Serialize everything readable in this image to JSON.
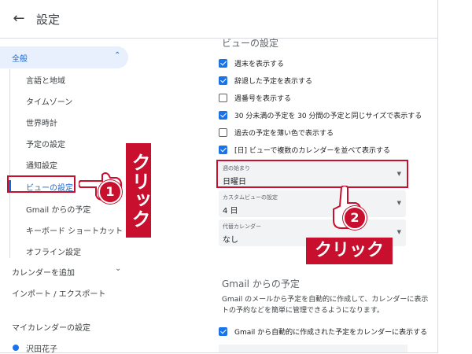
{
  "header": {
    "back_icon": "arrow-left-icon",
    "title": "設定"
  },
  "sidebar": {
    "general": {
      "label": "全般",
      "chevron": "⌃"
    },
    "sub_items": [
      {
        "label": "言語と地域"
      },
      {
        "label": "タイムゾーン"
      },
      {
        "label": "世界時計"
      },
      {
        "label": "予定の設定"
      },
      {
        "label": "通知設定"
      },
      {
        "label": "ビューの設定",
        "selected": true
      },
      {
        "label": "Gmail からの予定"
      },
      {
        "label": "キーボード ショートカット"
      },
      {
        "label": "オフライン設定"
      }
    ],
    "add_calendar": {
      "label": "カレンダーを追加",
      "chevron": "⌄"
    },
    "import_export": "インポート / エクスポート",
    "my_calendars": "マイカレンダーの設定",
    "user_name": "沢田花子"
  },
  "view_settings": {
    "title": "ビューの設定",
    "options": [
      {
        "label": "週末を表示する",
        "checked": true
      },
      {
        "label": "辞退した予定を表示する",
        "checked": true
      },
      {
        "label": "週番号を表示する",
        "checked": false
      },
      {
        "label": "30 分未満の予定を 30 分間の予定と同じサイズで表示する",
        "checked": true
      },
      {
        "label": "過去の予定を薄い色で表示する",
        "checked": false
      },
      {
        "label": "[日] ビューで複数のカレンダーを並べて表示する",
        "checked": true
      }
    ],
    "week_start": {
      "label": "週の始まり",
      "value": "日曜日"
    },
    "custom_view": {
      "label": "カスタムビューの設定",
      "value": "4 日"
    },
    "alt_calendar": {
      "label": "代替カレンダー",
      "value": "なし"
    },
    "dropdown_arrow": "▼"
  },
  "gmail_section": {
    "title": "Gmail からの予定",
    "description_line1": "Gmail のメールから予定を自動的に作成して、カレンダーに表示",
    "description_line2": "トの予約などを簡単に管理できるようになります。",
    "option": {
      "label": "Gmail から自動的に作成された予定をカレンダーに表示する",
      "checked": true
    }
  },
  "annotations": {
    "callout1": {
      "text": "クリック",
      "number": "1"
    },
    "callout2": {
      "text": "クリック",
      "number": "2"
    },
    "accent_color": "#c8102e"
  },
  "colors": {
    "accent": "#1a73e8",
    "selected_text": "#1967d2",
    "selected_bg": "#e8f0fe"
  }
}
